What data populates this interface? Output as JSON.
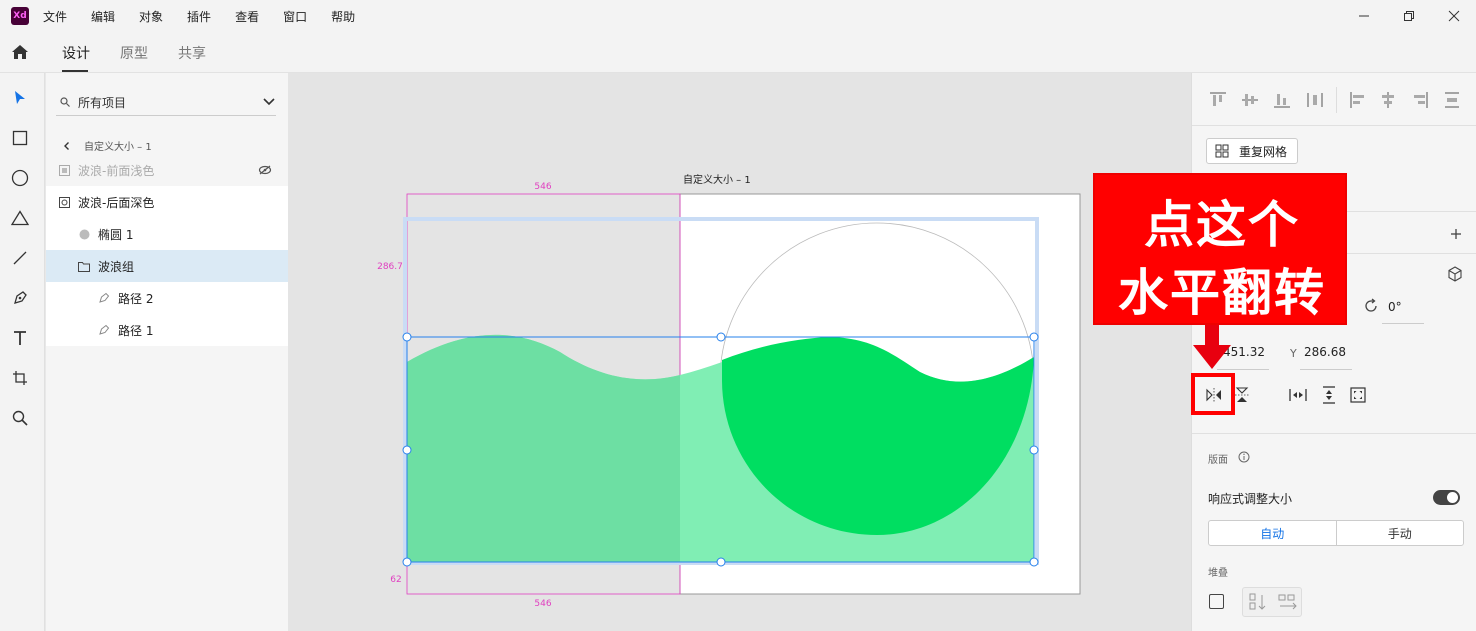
{
  "app": {
    "logo": "Xd"
  },
  "menu": [
    "文件",
    "编辑",
    "对象",
    "插件",
    "查看",
    "窗口",
    "帮助"
  ],
  "window_controls": [
    "minimize",
    "restore",
    "close"
  ],
  "tabs": [
    {
      "label": "设计",
      "active": true
    },
    {
      "label": "原型",
      "active": false
    },
    {
      "label": "共享",
      "active": false
    }
  ],
  "tools": [
    "select-icon",
    "rectangle-icon",
    "ellipse-icon",
    "polygon-icon",
    "line-icon",
    "pen-icon",
    "text-icon",
    "artboard-icon",
    "zoom-icon"
  ],
  "layers": {
    "search_label": "所有项目",
    "back_label": "自定义大小 – 1",
    "items": [
      {
        "label": "波浪-前面浅色",
        "hidden": true
      },
      {
        "label": "波浪-后面深色"
      },
      {
        "label": "椭圆 1"
      },
      {
        "label": "波浪组",
        "selected": true
      },
      {
        "label": "路径 2"
      },
      {
        "label": "路径 1"
      }
    ]
  },
  "canvas": {
    "artboard_label": "自定义大小 – 1",
    "dim_top": "546",
    "dim_bottom": "546",
    "dim_left": "286.7",
    "dim_bottom_left": "62",
    "colors": {
      "light_wave": "#80eeb4",
      "dark_wave": "#00de61",
      "selection": "#2680eb",
      "guide": "#e040c0"
    }
  },
  "rpanel": {
    "repeat_grid_label": "重复网格",
    "rotation": "0°",
    "x_value": "451.32",
    "y_label": "Y",
    "y_value": "286.68",
    "layout_label": "版面",
    "responsive_label": "响应式调整大小",
    "auto_label": "自动",
    "manual_label": "手动",
    "stack_label": "堆叠"
  },
  "annotation": {
    "line1": "点这个",
    "line2": "水平翻转",
    "color": "#ff0000"
  }
}
